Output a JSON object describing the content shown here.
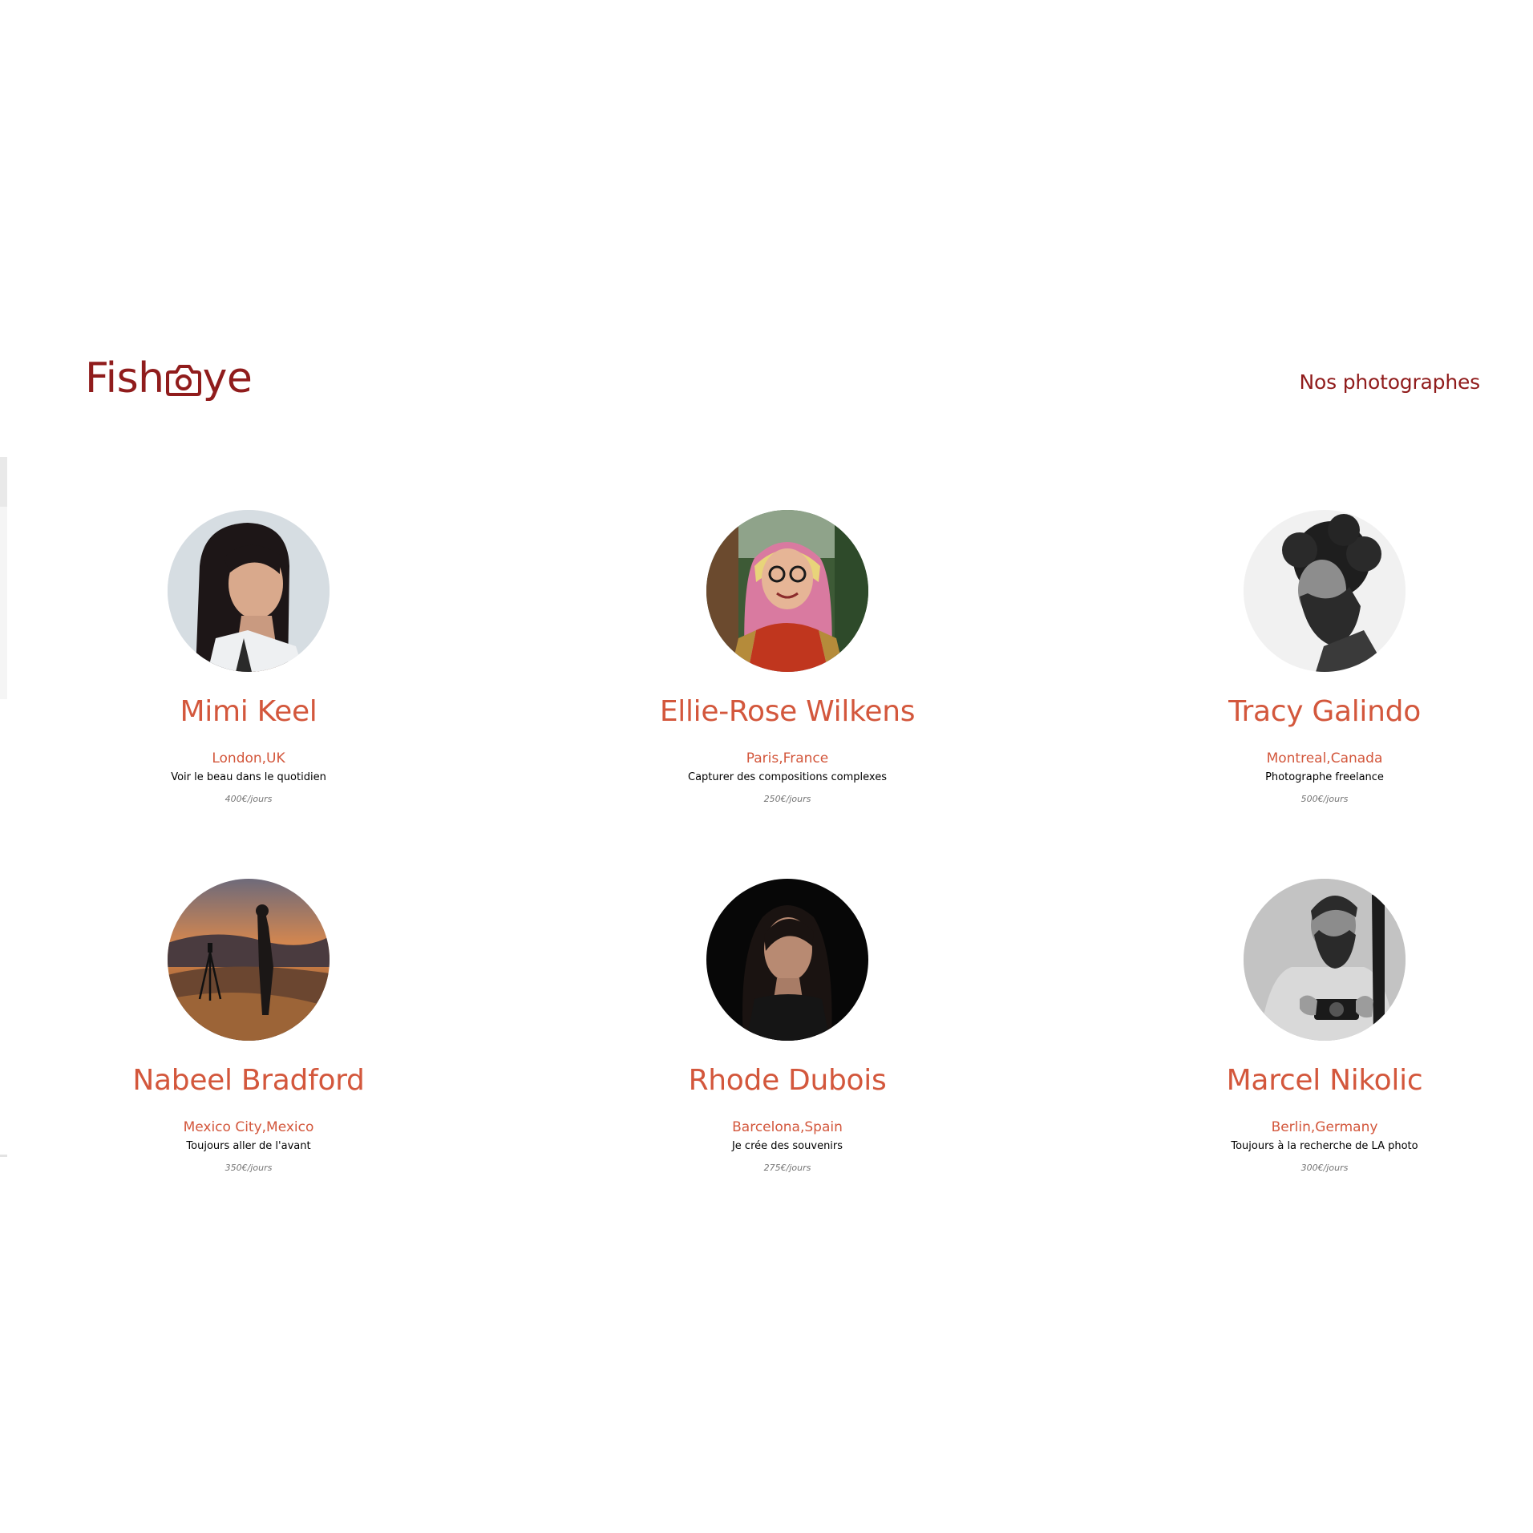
{
  "brand": {
    "name_prefix": "Fish",
    "name_suffix": "ye",
    "logo_icon": "camera-icon",
    "color": "#901c1c"
  },
  "header": {
    "page_heading": "Nos photographes"
  },
  "colors": {
    "accent": "#d3573c",
    "text": "#000000",
    "muted": "#757575"
  },
  "photographers": [
    {
      "name": "Mimi Keel",
      "location": "London,UK",
      "tagline": "Voir le beau dans le quotidien",
      "price": "400€/jours"
    },
    {
      "name": "Ellie-Rose Wilkens",
      "location": "Paris,France",
      "tagline": "Capturer des compositions complexes",
      "price": "250€/jours"
    },
    {
      "name": "Tracy Galindo",
      "location": "Montreal,Canada",
      "tagline": "Photographe freelance",
      "price": "500€/jours"
    },
    {
      "name": "Nabeel Bradford",
      "location": "Mexico City,Mexico",
      "tagline": "Toujours aller de l'avant",
      "price": "350€/jours"
    },
    {
      "name": "Rhode Dubois",
      "location": "Barcelona,Spain",
      "tagline": "Je crée des souvenirs",
      "price": "275€/jours"
    },
    {
      "name": "Marcel Nikolic",
      "location": "Berlin,Germany",
      "tagline": "Toujours à la recherche de LA photo",
      "price": "300€/jours"
    }
  ]
}
